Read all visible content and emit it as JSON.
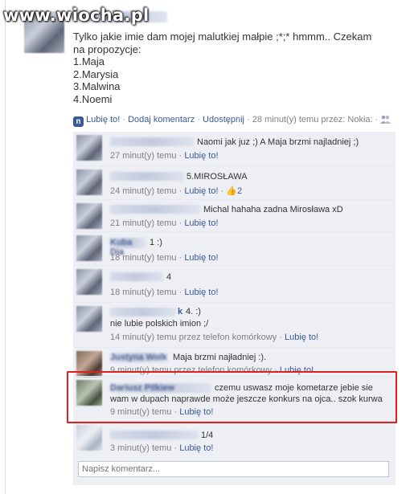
{
  "watermark": {
    "text": "www.wiocha.pl"
  },
  "post": {
    "lines": [
      "Tylko jakie imie dam mojej malutkiej małpie ;*;* hmmm.. Czekam",
      "na propozycje:",
      "1.Maja",
      "2.Marysia",
      "3.Malwina",
      "4.Noemi"
    ]
  },
  "actions": {
    "like": "Lubię to!",
    "sep": "·",
    "comment": "Dodaj komentarz",
    "share": "Udostępnij",
    "time": "28 minut(y) temu przez: Nokia:"
  },
  "comments": [
    {
      "text": "Naomi jak juz ;) A Maja brzmi najladniej ;)",
      "time": "27 minut(y) temu",
      "like": "Lubię to!"
    },
    {
      "text": "5.MIROSŁAWA",
      "time": "24 minut(y) temu",
      "like": "Lubię to!",
      "likes_count": "2"
    },
    {
      "text": "Michal hahaha zadna Mirosława xD",
      "time": "21 minut(y) temu",
      "like": "Lubię to!"
    },
    {
      "name": "Kuba Dia",
      "text": "1 :)",
      "time": "18 minut(y) temu",
      "like": "Lubię to!"
    },
    {
      "text": "4",
      "time": "18 minut(y) temu",
      "like": "Lubię to!"
    },
    {
      "name": "k",
      "text": "4. :)",
      "text2": "nie lubie polskich imion ;/",
      "time": "14 minut(y) temu przez telefon komórkowy",
      "like": "Lubię to!"
    },
    {
      "name": "Justyna Wolk",
      "text": "Maja brzmi najładniej :).",
      "time": "9 minut(y) temu przez telefon komórkowy",
      "like": "Lubię to!"
    },
    {
      "name": "Dariusz Pilkiew",
      "text": "czemu uswasz moje kometarze jebie sie",
      "text2": "wam w dupach naprawde może jeszcze konkurs na ojca.. szok kurwa",
      "time": "9 minut(y) temu",
      "like": "Lubię to!"
    },
    {
      "text": "1/4",
      "time": "3 minut(y) temu",
      "like": "Lubię to!"
    }
  ],
  "input": {
    "placeholder": "Napisz komentarz..."
  }
}
